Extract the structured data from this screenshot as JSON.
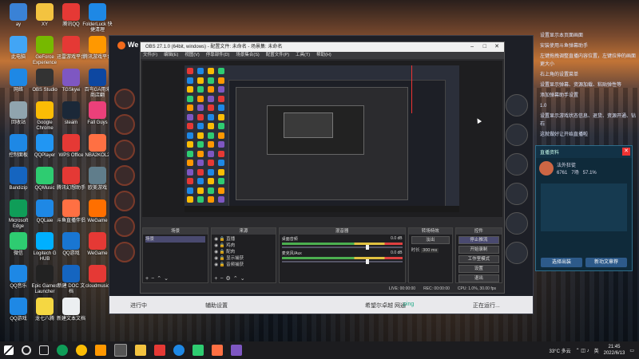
{
  "desktop_icons": [
    {
      "label": "ay",
      "color": "#3a82d6"
    },
    {
      "label": "XY",
      "color": "#f3c340"
    },
    {
      "label": "腾讯QQ",
      "color": "#e53935"
    },
    {
      "label": "FolderLuck 快捷清理",
      "color": "#1e88e5"
    },
    {
      "label": "此电脑",
      "color": "#42a5f5"
    },
    {
      "label": "GeForce Experience",
      "color": "#76b900"
    },
    {
      "label": "迅雷游戏平台",
      "color": "#e53935"
    },
    {
      "label": "腾讯游戏平台",
      "color": "#ff9800"
    },
    {
      "label": "网络",
      "color": "#1e88e5"
    },
    {
      "label": "OBS Studio",
      "color": "#333333"
    },
    {
      "label": "TGSkyei",
      "color": "#7e57c2"
    },
    {
      "label": "百鸟GA用来 商店翻",
      "color": "#0d47a1"
    },
    {
      "label": "回收站",
      "color": "#90a4ae"
    },
    {
      "label": "Google Chrome",
      "color": "#fbbc05"
    },
    {
      "label": "steam",
      "color": "#1b2838"
    },
    {
      "label": "Fall Guys",
      "color": "#ec407a"
    },
    {
      "label": "控制面板",
      "color": "#1e88e5"
    },
    {
      "label": "QQPlayer",
      "color": "#2196f3"
    },
    {
      "label": "WPS Office",
      "color": "#e53935"
    },
    {
      "label": "NBA2KOL2",
      "color": "#ff7043"
    },
    {
      "label": "Bandizip",
      "color": "#1565c0"
    },
    {
      "label": "QQMusic",
      "color": "#2ecc71"
    },
    {
      "label": "腾讯幻想助手",
      "color": "#e53935"
    },
    {
      "label": "欧美游戏",
      "color": "#607d8b"
    },
    {
      "label": "Microsoft Edge",
      "color": "#0f9d58"
    },
    {
      "label": "QQLaie",
      "color": "#1e88e5"
    },
    {
      "label": "斗鱼直播伴侣",
      "color": "#ff7043"
    },
    {
      "label": "WeGame",
      "color": "#ff6f00"
    },
    {
      "label": "微信",
      "color": "#2ecc71"
    },
    {
      "label": "Logitech G HUB",
      "color": "#00b0ff"
    },
    {
      "label": "QQ游戏",
      "color": "#1976d2"
    },
    {
      "label": "WeGame",
      "color": "#e53935"
    },
    {
      "label": "QQ音乐",
      "color": "#1e88e5"
    },
    {
      "label": "Epic Games Launcher",
      "color": "#222222"
    },
    {
      "label": "新建 DOC 文档",
      "color": "#1565c0"
    },
    {
      "label": "cloudmusic",
      "color": "#e53935"
    },
    {
      "label": "QQ游戏",
      "color": "#1e88e5"
    },
    {
      "label": "龙七八腾",
      "color": "#f5d742"
    },
    {
      "label": "新建文本文档",
      "color": "#eceff1"
    }
  ],
  "wegame": {
    "logo": "We",
    "bottom_left": "进行中",
    "bottom_mid1": "辅助设置",
    "bottom_mid2": "希望尔卓越 网通",
    "bottom_badge": "ping",
    "bottom_right": "正在运行..."
  },
  "obs": {
    "title": "OBS 27.1.0 (64bit, windows) - 配置文件: 未命名 - 场景集: 未命名",
    "menu": [
      "文件(F)",
      "编辑(E)",
      "视图(V)",
      "停靠部件(D)",
      "场景集合(S)",
      "配置文件(P)",
      "工具(T)",
      "帮助(H)"
    ],
    "docks": {
      "scenes": {
        "title": "场景",
        "items": [
          "场景"
        ]
      },
      "sources": {
        "title": "来源",
        "items": [
          "直播",
          "鸡肉",
          "配肉",
          "显示捕获",
          "音频捕获"
        ]
      },
      "mixer": {
        "title": "混音器",
        "rows": [
          {
            "label": "桌面音频",
            "db": "0.0 dB"
          },
          {
            "label": "麦克风/Aux",
            "db": "0.0 dB"
          }
        ]
      },
      "transitions": {
        "title": "转场特效",
        "type": "淡出",
        "duration_label": "时长",
        "duration": "300 ms"
      },
      "controls": {
        "title": "控件",
        "buttons": [
          "停止推流",
          "开始录制",
          "工作室模式",
          "设置",
          "退出"
        ]
      }
    },
    "status": {
      "live": "LIVE: 00:00:00",
      "rec": "REC: 00:00:00",
      "cpu": "CPU: 1.0%, 30.00 fps"
    }
  },
  "right_notes": [
    "设置显示本页面画面",
    "安装使用斗鱼弹幕助手",
    "左键拖拽调整直播内容位置，左键拉伸的画面更大小",
    "右上角的设置菜单",
    "设置显示弹幕、资源加载、粘贴弹性等",
    "添加弹幕助手设置",
    "1.0",
    "设置显示游戏状态信息、退货、资源开通、钻石",
    "这就做好让开始直播啦"
  ],
  "game_panel": {
    "title": "直播资料",
    "player": "法外狂徒",
    "stats": [
      "6761",
      "7场",
      "57.1%"
    ],
    "btn_left": "选择出装",
    "btn_right": "新功文章荐"
  },
  "taskbar": {
    "weather": "33°C 多云",
    "time": "21:45",
    "date": "2022/6/13",
    "lang": "英"
  },
  "colors": {
    "obs_bg": "#2b2b2e",
    "accent": "#f26a1b",
    "panel": "#0f2a3a"
  }
}
